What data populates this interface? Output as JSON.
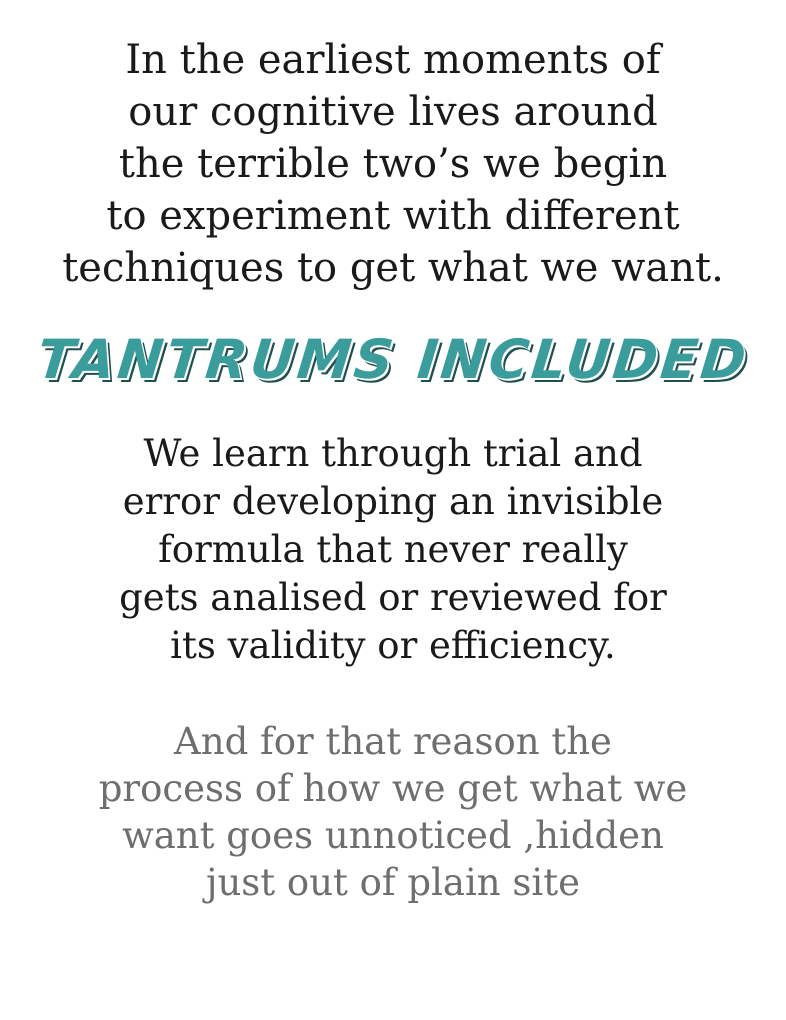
{
  "intro": {
    "lines": [
      "In the earliest moments of",
      "our cognitive lives around",
      "the terrible two’s we begin",
      "to experiment with different",
      "techniques to get what we want."
    ]
  },
  "heading": {
    "text": "TANTRUMS INCLUDED",
    "color": "#3b9c9c"
  },
  "middle": {
    "lines": [
      "We learn through trial and",
      "error developing an invisible",
      "formula that never really",
      "gets analised or reviewed for",
      "its validity or efficiency."
    ]
  },
  "closing": {
    "lines": [
      "And for that reason the",
      "process of how we get what we",
      "want goes unnoticed ,hidden",
      "just out of plain site"
    ],
    "color": "#6e6e6e"
  }
}
